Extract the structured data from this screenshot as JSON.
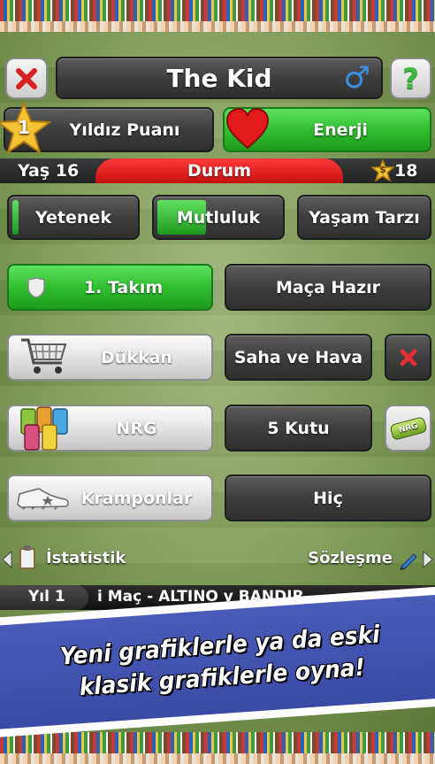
{
  "header": {
    "close_icon": "close-icon",
    "player_name": "The Kid",
    "gender_symbol": "♂",
    "help_symbol": "?"
  },
  "stats": {
    "star_number": "1",
    "star_label": "Yıldız Puanı",
    "energy_label": "Enerji"
  },
  "status": {
    "age": "Yaş 16",
    "title": "Durum",
    "coins": "18",
    "coin_symbol": "$"
  },
  "attributes": {
    "talent": {
      "label": "Yetenek",
      "level": 0.05
    },
    "happiness": {
      "label": "Mutluluk",
      "level": 0.4
    },
    "lifestyle": {
      "label": "Yaşam Tarzı"
    }
  },
  "rows": {
    "team": {
      "label": "1. Takım",
      "status": "Maça Hazır"
    },
    "shop": {
      "label": "Dükkan",
      "status": "Saha ve Hava"
    },
    "nrg": {
      "label": "NRG",
      "status": "5 Kutu",
      "can_text": "NRG"
    },
    "boots": {
      "label": "Kramponlar",
      "status": "Hiç"
    }
  },
  "footer": {
    "stats_label": "İstatistik",
    "contract_label": "Sözleşme"
  },
  "ticker": {
    "year": "Yıl 1",
    "match": "i Maç - ALTINO v BANDIR"
  },
  "banner": {
    "line1": "Yeni grafiklerle ya da eski",
    "line2": "klasik grafiklerle oyna!"
  },
  "colors": {
    "accent_green": "#2fbf2f",
    "status_red": "#e01818",
    "banner_blue": "#3f50ad"
  }
}
